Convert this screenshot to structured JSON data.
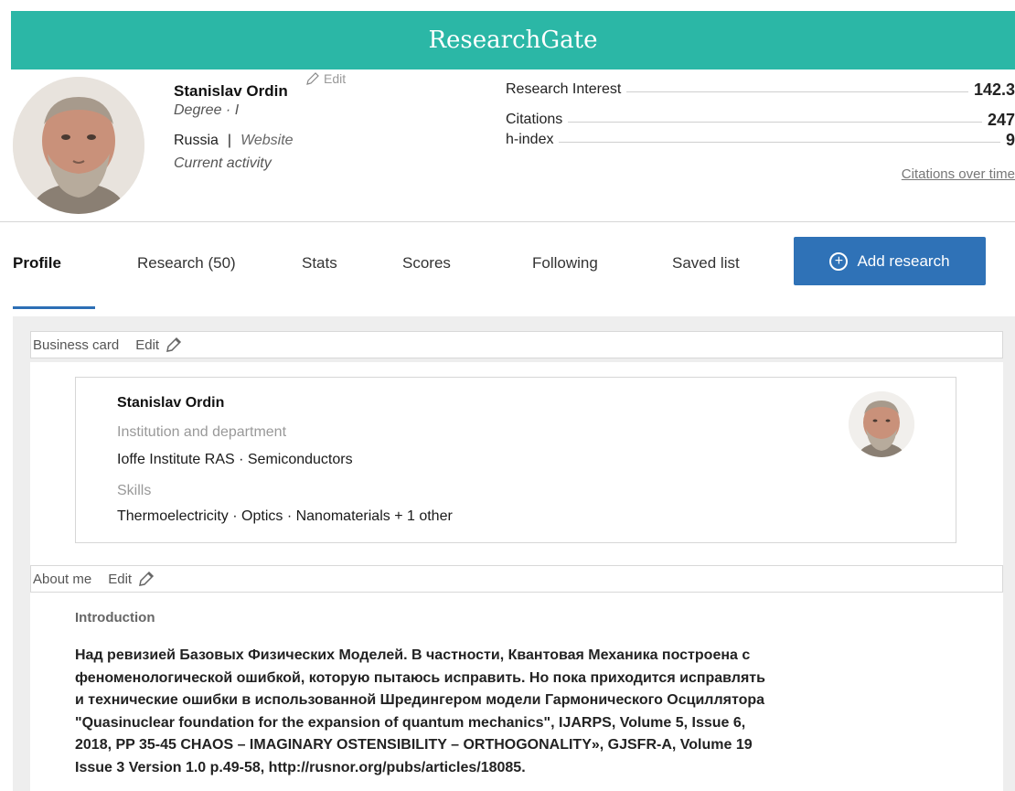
{
  "header": {
    "brand": "ResearchGate"
  },
  "profile": {
    "name": "Stanislav Ordin",
    "edit_label": "Edit",
    "degree": "Degree · I",
    "country": "Russia",
    "separator": "|",
    "website": "Website",
    "activity": "Current activity"
  },
  "metrics": [
    {
      "label": "Research Interest",
      "value": "142.3"
    },
    {
      "label": "Citations",
      "value": "247"
    },
    {
      "label": "h-index",
      "value": "9"
    }
  ],
  "citations_link": "Citations over time",
  "tabs": [
    "Profile",
    "Research (50)",
    "Stats",
    "Scores",
    "Following",
    "Saved list"
  ],
  "active_tab": "Profile",
  "add_button": {
    "label": "Add research",
    "icon": "plus-circle-icon"
  },
  "business_card": {
    "title": "Business card",
    "edit": "Edit",
    "name": "Stanislav Ordin",
    "institution_label": "Institution and department",
    "institution": "Ioffe Institute RAS · Semiconductors",
    "skills_label": "Skills",
    "skills": "Thermoelectricity · Optics · Nanomaterials + 1 other"
  },
  "about": {
    "title": "About me",
    "edit": "Edit",
    "intro_heading": "Introduction",
    "intro_lines": [
      "Над ревизией Базовых Физических Моделей. В частности, Квантовая Механика построена с",
      "феноменологической ошибкой, которую пытаюсь исправить. Но пока приходится исправлять",
      "и технические ошибки в использованной Шредингером модели Гармонического Осциллятора",
      "\"Quasinuclear foundation for the expansion of quantum mechanics\", IJARPS, Volume 5, Issue 6,",
      "2018, PP 35-45 CHAOS – IMAGINARY OSTENSIBILITY – ORTHOGONALITY», GJSFR-A, Volume 19",
      "Issue 3 Version 1.0 p.49-58, http://rusnor.org/pubs/articles/18085."
    ]
  },
  "colors": {
    "brand": "#2bb7a6",
    "accent": "#2f72b7",
    "tab_underline": "#2d6fb5"
  }
}
